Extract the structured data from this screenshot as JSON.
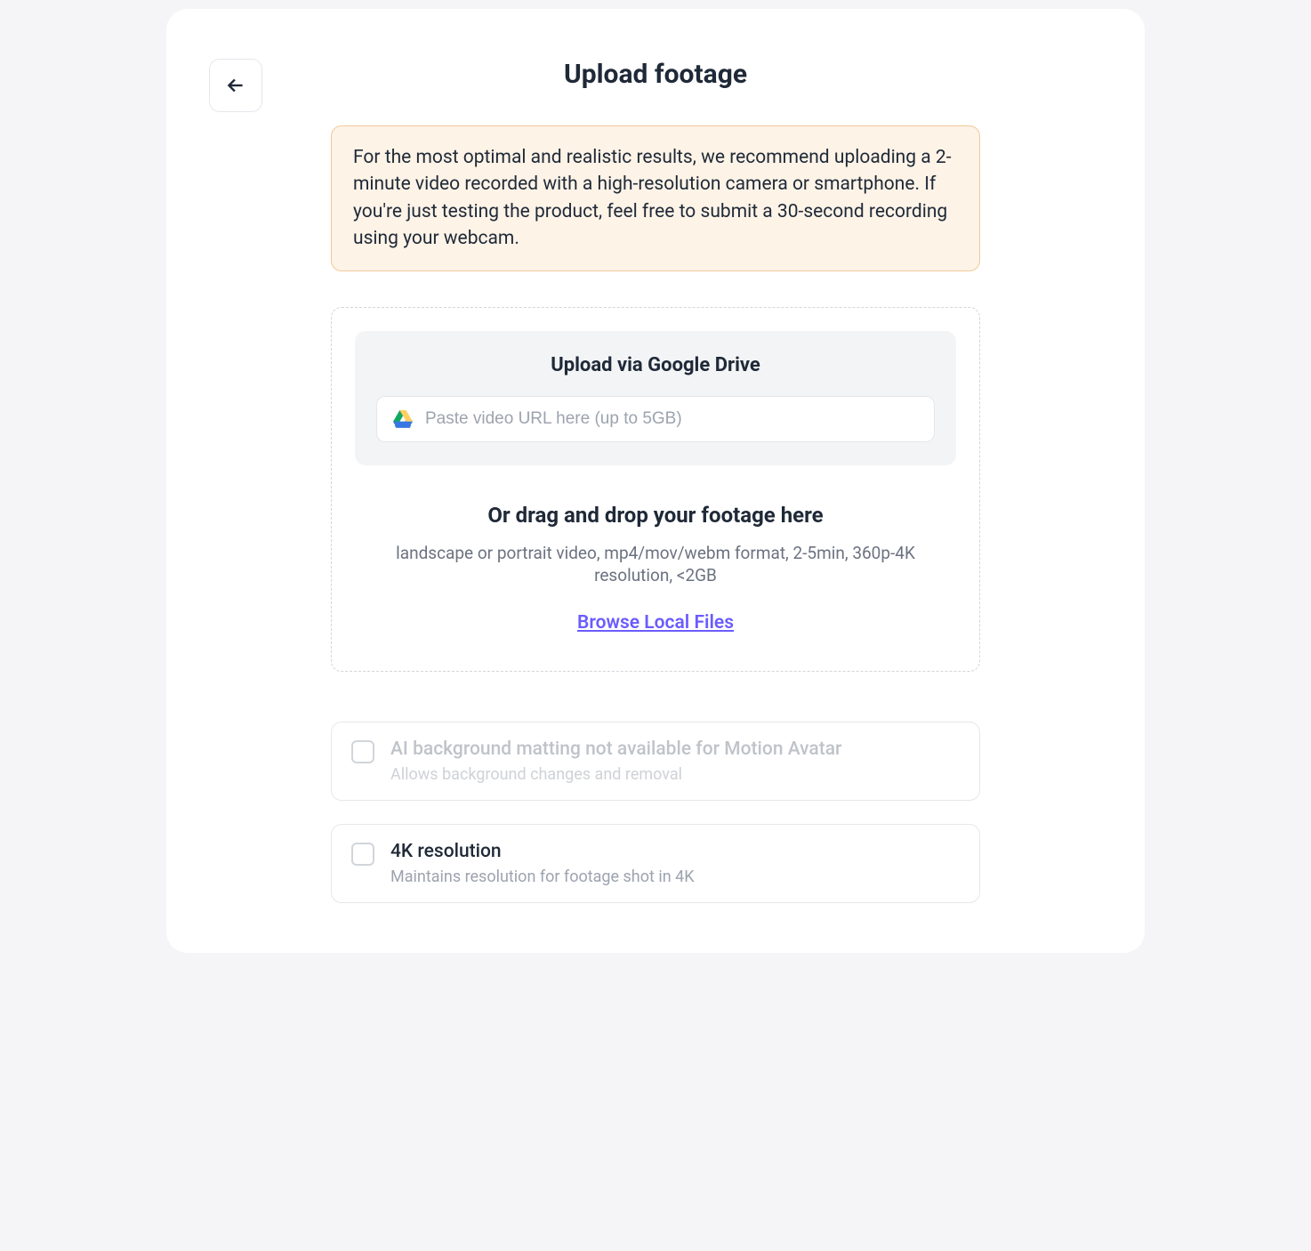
{
  "page": {
    "title": "Upload footage"
  },
  "banner": {
    "text": "For the most optimal and realistic results, we recommend uploading a 2-minute video recorded with a high-resolution camera or smartphone. If you're just testing the product, feel free to submit a 30-second recording using your webcam."
  },
  "upload": {
    "gdrive": {
      "title": "Upload via Google Drive",
      "placeholder": "Paste video URL here (up to 5GB)",
      "value": ""
    },
    "drop": {
      "title": "Or drag and drop your footage here",
      "subtitle": "landscape or portrait video, mp4/mov/webm format, 2-5min, 360p-4K resolution, <2GB",
      "browse_label": "Browse Local Files"
    }
  },
  "options": {
    "matting": {
      "label": "AI background matting not available for Motion Avatar",
      "desc": "Allows background changes and removal",
      "checked": false,
      "disabled": true
    },
    "fourk": {
      "label": "4K resolution",
      "desc": "Maintains resolution for footage shot in 4K",
      "checked": false,
      "disabled": false
    }
  }
}
